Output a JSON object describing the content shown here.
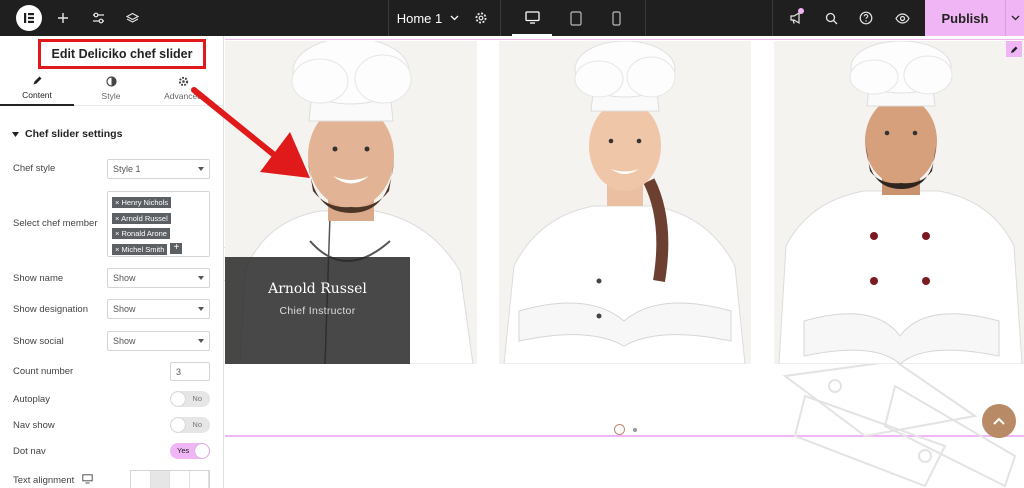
{
  "topbar": {
    "page_name": "Home 1",
    "publish_label": "Publish"
  },
  "panel": {
    "title": "Edit Deliciko chef slider",
    "tabs": [
      {
        "label": "Content",
        "icon": "pencil-icon"
      },
      {
        "label": "Style",
        "icon": "half-circle-icon"
      },
      {
        "label": "Advanced",
        "icon": "gear-icon"
      }
    ],
    "section_title": "Chef slider settings",
    "fields": {
      "chef_style": {
        "label": "Chef style",
        "value": "Style 1"
      },
      "select_member": {
        "label": "Select chef member",
        "tags": [
          "Henry Nichols",
          "Arnold Russel",
          "Ronald Arone",
          "Michel Smith"
        ]
      },
      "show_name": {
        "label": "Show name",
        "value": "Show"
      },
      "show_designation": {
        "label": "Show designation",
        "value": "Show"
      },
      "show_social": {
        "label": "Show social",
        "value": "Show"
      },
      "count_number": {
        "label": "Count number",
        "value": "3"
      },
      "autoplay": {
        "label": "Autoplay",
        "value": "No"
      },
      "nav_show": {
        "label": "Nav show",
        "value": "No"
      },
      "dot_nav": {
        "label": "Dot nav",
        "value": "Yes"
      },
      "text_alignment": {
        "label": "Text alignment"
      }
    }
  },
  "canvas": {
    "featured_chef": {
      "name": "Arnold Russel",
      "designation": "Chief Instructor"
    }
  },
  "colors": {
    "accent": "#f0b5f5",
    "topbar": "#1f1f1f",
    "annotation": "#e01a1a",
    "scroll_top": "#b88a66"
  }
}
